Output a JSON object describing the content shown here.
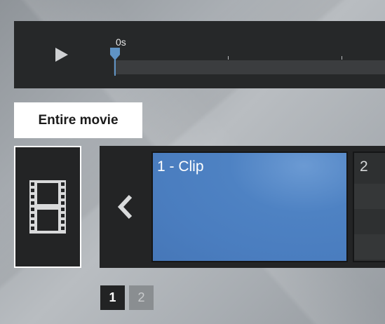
{
  "timeline": {
    "time_label": "0s",
    "play_icon": "play-icon",
    "playhead_icon": "playhead-marker-icon"
  },
  "entire_movie": {
    "label": "Entire movie",
    "icon": "film-strip-icon"
  },
  "clips": [
    {
      "label": "1 - Clip"
    },
    {
      "label": "2"
    }
  ],
  "navigation": {
    "prev_icon": "chevron-left-icon"
  },
  "pagination": {
    "pages": [
      "1",
      "2"
    ],
    "current": "1"
  },
  "colors": {
    "panel": "#262829",
    "clip_blue": "#4a7dbf",
    "accent_playhead": "#5f93c4"
  }
}
